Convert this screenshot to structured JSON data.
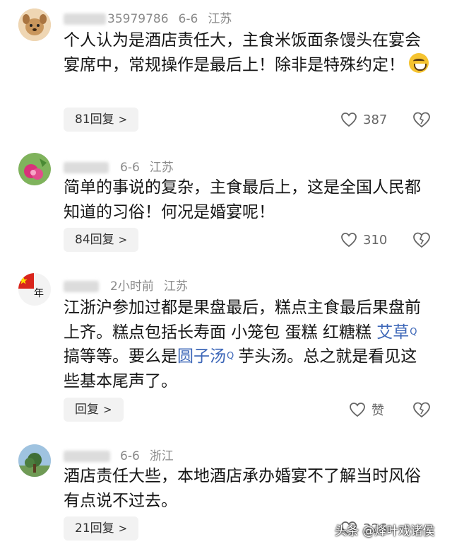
{
  "comments": [
    {
      "name_suffix": "35979786",
      "date": "6-6",
      "location": "江苏",
      "content_text": "个人认为是酒店责任大，主食米饭面条馒头在宴会宴席中，常规操作是最后上！除非是特殊约定！",
      "reply_label": "81回复",
      "likes": "387",
      "avatar_icon": "dog-avatar-icon"
    },
    {
      "date": "6-6",
      "location": "江苏",
      "content_text": "简单的事说的复杂，主食最后上，这是全国人民都知道的习俗！何况是婚宴呢！",
      "reply_label": "84回复",
      "likes": "310",
      "avatar_icon": "flower-avatar-icon"
    },
    {
      "time": "2小时前",
      "location": "江苏",
      "content_part1": "江浙沪参加过都是果盘最后，糕点主食最后果盘前上齐。糕点包括长寿面 小笼包 蛋糕 红糖糕 ",
      "link1": "艾草",
      "content_part2": "搞等等。要么是",
      "link2": "圆子汤",
      "content_part3": "芋头汤。总之就是看见这些基本尾声了。",
      "reply_label": "回复",
      "likes": "赞",
      "avatar_icon": "flag-avatar-icon",
      "avatar_text": "年"
    },
    {
      "date": "6-6",
      "location": "浙江",
      "content_text": "酒店责任大些，本地酒店承办婚宴不了解当时风俗有点说不过去。",
      "reply_label": "21回复",
      "likes": "326",
      "avatar_icon": "tree-avatar-icon"
    }
  ],
  "watermark": "头条 @烽叶戏诸侯",
  "colors": {
    "link": "#3d67b8",
    "meta": "#8a8a8a",
    "reply_bg": "#f2f2f2"
  }
}
